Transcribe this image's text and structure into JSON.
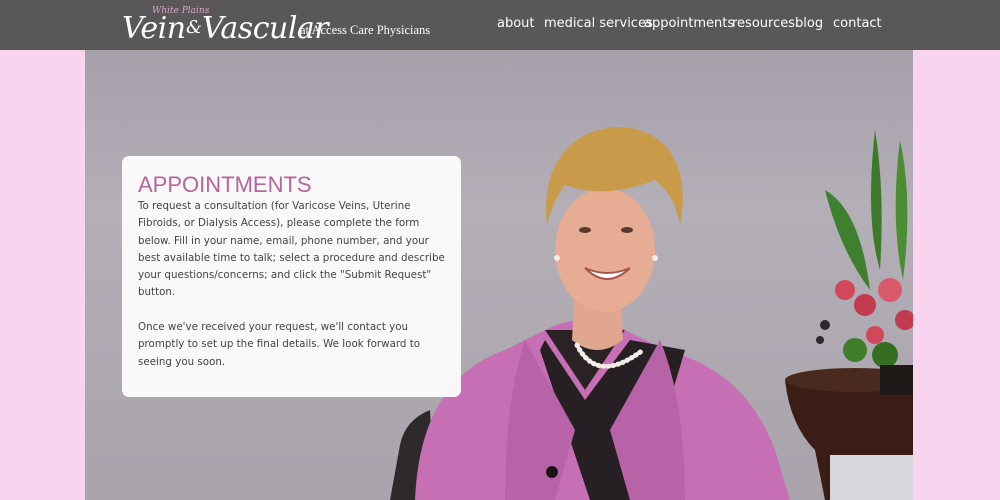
{
  "header": {
    "logo": {
      "small_text": "White Plains",
      "vein": "Vein",
      "amp": "&",
      "vascular": "Vascular",
      "subtitle": "at Access Care Physicians"
    },
    "nav": [
      {
        "label": "about"
      },
      {
        "label": "medical services"
      },
      {
        "label": "appointments"
      },
      {
        "label": "resources"
      },
      {
        "label": "blog"
      },
      {
        "label": "contact"
      }
    ]
  },
  "panel": {
    "title": "APPOINTMENTS",
    "paragraph1": "To request a consultation (for Varicose Veins, Uterine Fibroids, or Dialysis Access), please complete the form below. Fill in your name, email, phone number, and your best available time to talk; select a procedure and describe your questions/concerns; and click the \"Submit Request\" button.",
    "paragraph2": "Once we've received your request, we'll contact you promptly to set up the final details. We look forward to seeing you soon."
  },
  "colors": {
    "page_background": "#f8d4ef",
    "header_background": "#5a5758",
    "title_color": "#b5649d",
    "jacket_color": "#c66fb4"
  }
}
